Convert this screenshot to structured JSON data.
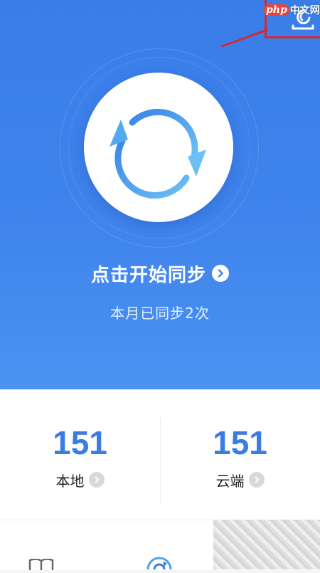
{
  "watermark": {
    "brand": "php",
    "site": "中文网"
  },
  "main": {
    "start_sync_label": "点击开始同步",
    "month_count_text": "本月已同步2次"
  },
  "stats": {
    "local": {
      "value": "151",
      "label": "本地"
    },
    "cloud": {
      "value": "151",
      "label": "云端"
    }
  },
  "icons": {
    "header": "cleanup-icon",
    "sync": "sync-arrows-icon",
    "nav_book": "book-icon",
    "nav_sync": "sync-icon"
  },
  "colors": {
    "hero_blue": "#3f83ec",
    "accent_blue": "#3a7ce0",
    "annotation_red": "#d4292f",
    "ring_blue": "#4a9be8"
  }
}
